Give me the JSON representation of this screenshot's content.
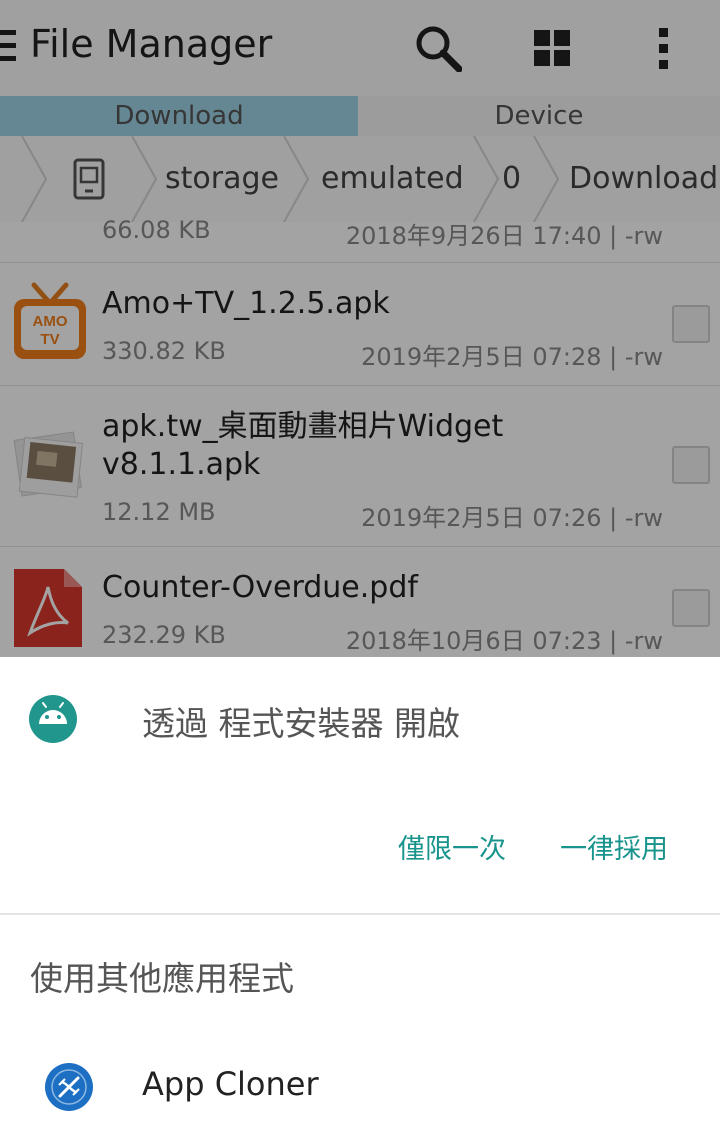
{
  "appbar": {
    "title": "File Manager"
  },
  "tabs": [
    {
      "label": "Download",
      "active": true
    },
    {
      "label": "Device",
      "active": false
    }
  ],
  "breadcrumb": [
    "storage",
    "emulated",
    "0",
    "Download"
  ],
  "files": [
    {
      "name": "",
      "size": "66.08 KB",
      "date": "2018年9月26日 17:40 | -rw"
    },
    {
      "name": "Amo+TV_1.2.5.apk",
      "size": "330.82 KB",
      "date": "2019年2月5日 07:28 | -rw",
      "icon_text": "AMO TV"
    },
    {
      "name_line1": "apk.tw_桌面動畫相片Widget",
      "name_line2": "v8.1.1.apk",
      "size": "12.12 MB",
      "date": "2019年2月5日 07:26 | -rw"
    },
    {
      "name": "Counter-Overdue.pdf",
      "size": "232.29 KB",
      "date": "2018年10月6日 07:23 | -rw"
    }
  ],
  "sheet": {
    "open_with_title": "透過 程式安裝器 開啟",
    "just_once": "僅限一次",
    "always": "一律採用",
    "other_apps_title": "使用其他應用程式",
    "apps": [
      {
        "label": "App Cloner"
      }
    ]
  },
  "colors": {
    "accent": "#18948c",
    "tab_active": "#9ed4e7",
    "installer_icon": "#20968d",
    "cloner_icon": "#1c6fc3"
  }
}
